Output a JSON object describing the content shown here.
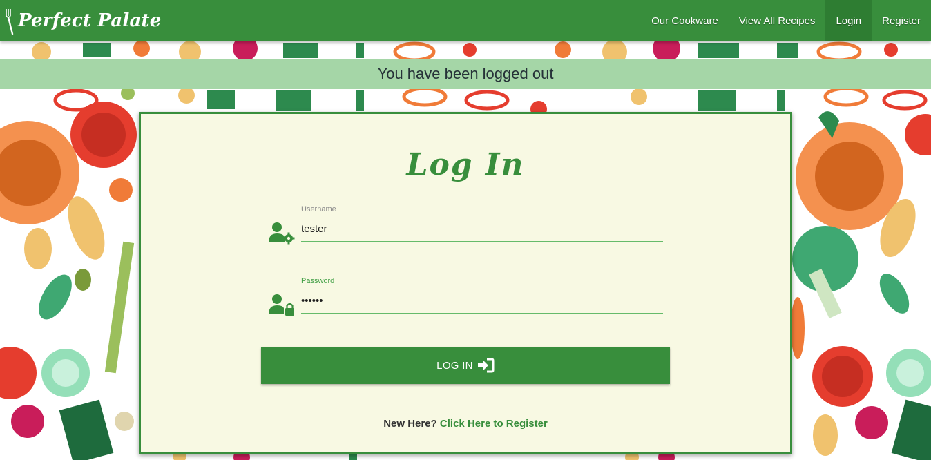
{
  "nav": {
    "brand": "Perfect Palate",
    "links": [
      {
        "label": "Our Cookware"
      },
      {
        "label": "View All Recipes"
      },
      {
        "label": "Login"
      },
      {
        "label": "Register"
      }
    ]
  },
  "flash": {
    "message": "You have been logged out"
  },
  "login": {
    "title": "Log In",
    "username_label": "Username",
    "username_value": "tester",
    "password_label": "Password",
    "password_value": "••••••",
    "button_label": "LOG IN",
    "register_prompt": "New Here?",
    "register_link": "Click Here to Register"
  },
  "colors": {
    "primary": "#388e3c",
    "primary_dark": "#2e7d32",
    "flash_bg": "#a5d6a7",
    "card_bg": "#f8f9e3"
  },
  "icons": {
    "brand": "fork-icon",
    "username": "user-cog-icon",
    "password": "user-lock-icon",
    "button": "sign-in-icon"
  }
}
